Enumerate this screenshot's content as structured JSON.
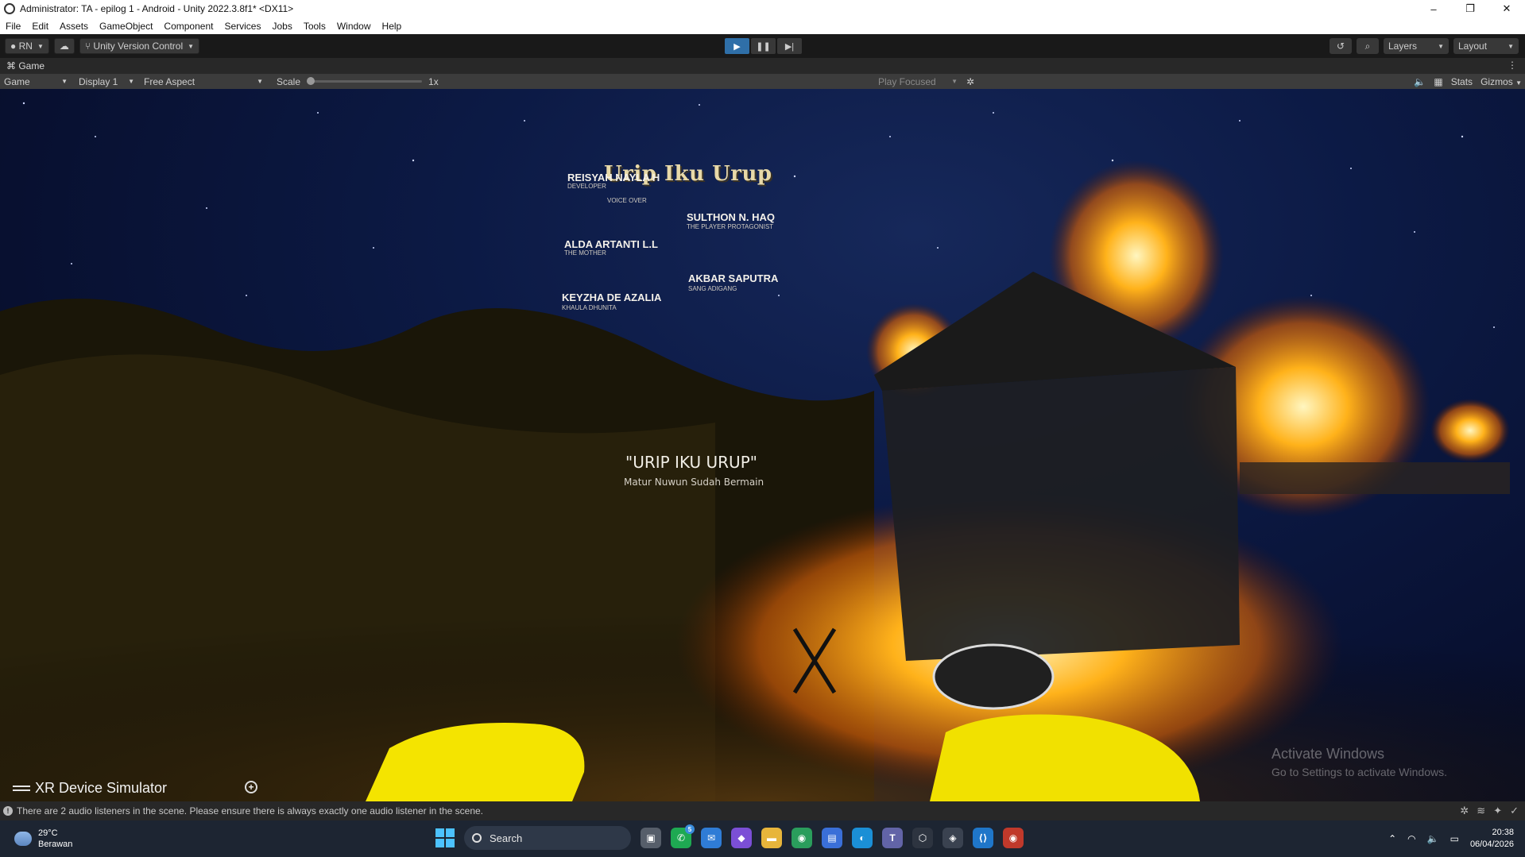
{
  "window": {
    "title": "Administrator: TA - epilog 1 - Android - Unity 2022.3.8f1* <DX11>",
    "controls": [
      "–",
      "❐",
      "✕"
    ]
  },
  "menu": [
    "File",
    "Edit",
    "Assets",
    "GameObject",
    "Component",
    "Services",
    "Jobs",
    "Tools",
    "Window",
    "Help"
  ],
  "toolbar": {
    "account": "RN",
    "version_control": "Unity Version Control",
    "layers": "Layers",
    "layout": "Layout"
  },
  "game_tab": {
    "label": "Game"
  },
  "game_controls": {
    "view": "Game",
    "display": "Display 1",
    "aspect": "Free Aspect",
    "scale_label": "Scale",
    "scale_value": "1x",
    "scale_level": 0,
    "play_mode": "Play Focused",
    "stats": "Stats",
    "gizmos": "Gizmos"
  },
  "credits": {
    "logo": "Urip Iku Urup",
    "people": [
      {
        "name": "REISYAH NAYLA H",
        "role": "DEVELOPER"
      },
      {
        "name": "",
        "role": "VOICE OVER"
      },
      {
        "name": "SULTHON N. HAQ",
        "role": "THE PLAYER PROTAGONIST"
      },
      {
        "name": "ALDA ARTANTI L.L",
        "role": "THE MOTHER"
      },
      {
        "name": "AKBAR SAPUTRA",
        "role": "SANG ADIGANG"
      },
      {
        "name": "KEYZHA DE AZALIA",
        "role": "KHAULA DHUNITA"
      }
    ],
    "closing_title": "\"URIP IKU URUP\"",
    "closing_subtitle": "Matur Nuwun Sudah Bermain"
  },
  "xr_simulator": {
    "label": "XR Device Simulator"
  },
  "activation": {
    "title": "Activate Windows",
    "subtitle": "Go to Settings to activate Windows."
  },
  "status": {
    "message": "There are 2 audio listeners in the scene. Please ensure there is always exactly one audio listener in the scene."
  },
  "taskbar": {
    "weather_temp": "29°C",
    "weather_desc": "Berawan",
    "search_placeholder": "Search",
    "whatsapp_badge": "5",
    "time": "20:38",
    "date": "06/04/2026"
  },
  "colors": {
    "play_active": "#2f6fa8",
    "fire": "#ffb020",
    "sky": "#0c1a45"
  }
}
